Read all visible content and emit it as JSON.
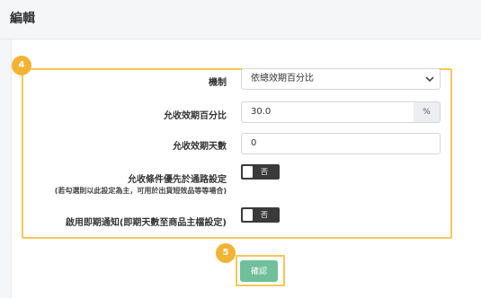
{
  "header": {
    "title": "編輯"
  },
  "steps": {
    "form_step": "4",
    "confirm_step": "5"
  },
  "form": {
    "mechanism": {
      "label": "機制",
      "selected": "依總效期百分比"
    },
    "percent": {
      "label": "允收效期百分比",
      "value": "30.0",
      "unit": "%"
    },
    "days": {
      "label": "允收效期天數",
      "value": "0"
    },
    "priority": {
      "label": "允收條件優先於通路設定",
      "note": "(若勾選則以此設定為主，可用於出貨短效品等等場合)",
      "toggle_text": "否"
    },
    "expiry_notice": {
      "label": "啟用即期通知(即期天數至商品主檔設定)",
      "toggle_text": "否"
    }
  },
  "actions": {
    "confirm_label": "確認"
  },
  "colors": {
    "highlight": "#f0c95a",
    "badge": "#f2b233",
    "confirm": "#6fbf9a",
    "toggle_off": "#3a3a3a"
  }
}
